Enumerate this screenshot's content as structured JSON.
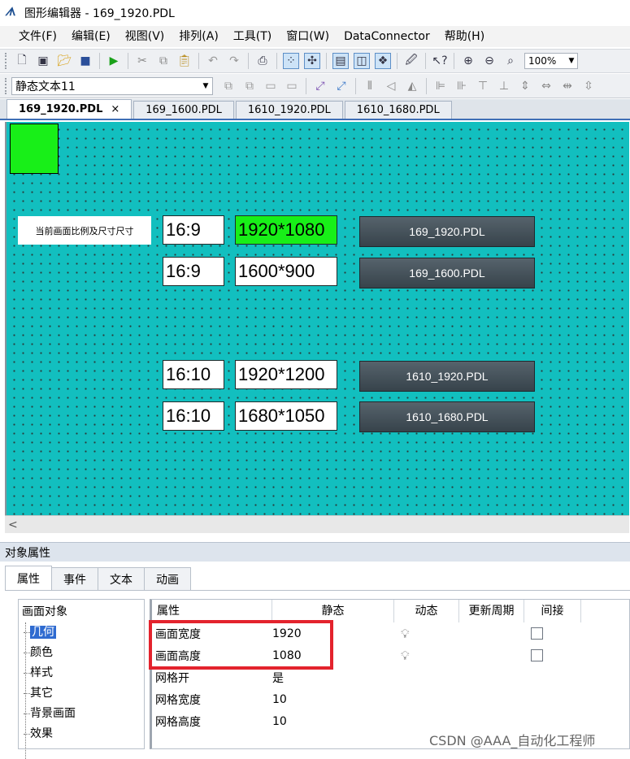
{
  "window": {
    "title": "图形编辑器 - 169_1920.PDL",
    "icon": "app-logo-icon"
  },
  "menu": [
    "文件(F)",
    "编辑(E)",
    "视图(V)",
    "排列(A)",
    "工具(T)",
    "窗口(W)",
    "DataConnector",
    "帮助(H)"
  ],
  "toolbar": {
    "zoom": "100%"
  },
  "object_selector": {
    "value": "静态文本11"
  },
  "doc_tabs": [
    {
      "label": "169_1920.PDL",
      "active": true,
      "close": "×"
    },
    {
      "label": "169_1600.PDL",
      "active": false
    },
    {
      "label": "1610_1920.PDL",
      "active": false
    },
    {
      "label": "1610_1680.PDL",
      "active": false
    }
  ],
  "canvas": {
    "info_label": "当前画面比例及尺寸尺寸",
    "rows": [
      {
        "ratio": "16:9",
        "resolution": "1920*1080",
        "button": "169_1920.PDL",
        "highlight": true
      },
      {
        "ratio": "16:9",
        "resolution": "1600*900",
        "button": "169_1600.PDL",
        "highlight": false
      },
      {
        "ratio": "16:10",
        "resolution": "1920*1200",
        "button": "1610_1920.PDL",
        "highlight": false
      },
      {
        "ratio": "16:10",
        "resolution": "1680*1050",
        "button": "1610_1680.PDL",
        "highlight": false
      }
    ],
    "colors": {
      "background": "#12bfbf",
      "square": "#18ef18",
      "highlight": "#18ef18"
    }
  },
  "scroll": {
    "left_arrow": "<"
  },
  "properties": {
    "header": "对象属性",
    "tabs": [
      "属性",
      "事件",
      "文本",
      "动画"
    ],
    "tree": {
      "root": "画面对象",
      "items": [
        "几何",
        "颜色",
        "样式",
        "其它",
        "背景画面",
        "效果"
      ],
      "selected": "几何"
    },
    "columns": [
      "属性",
      "静态",
      "动态",
      "更新周期",
      "间接"
    ],
    "rows": [
      {
        "name": "画面宽度",
        "static": "1920",
        "dynamic": true,
        "indirect": true
      },
      {
        "name": "画面高度",
        "static": "1080",
        "dynamic": true,
        "indirect": true
      },
      {
        "name": "网格开",
        "static": "是",
        "dynamic": false,
        "indirect": false
      },
      {
        "name": "网格宽度",
        "static": "10",
        "dynamic": false,
        "indirect": false
      },
      {
        "name": "网格高度",
        "static": "10",
        "dynamic": false,
        "indirect": false
      }
    ]
  },
  "watermark": "CSDN @AAA_自动化工程师"
}
